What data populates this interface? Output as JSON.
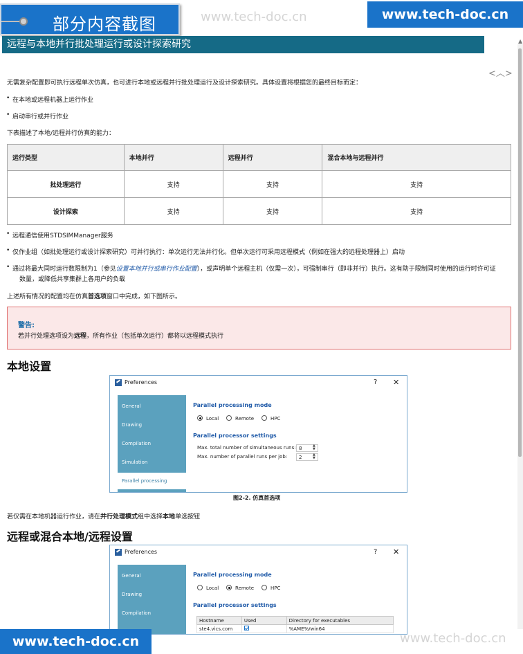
{
  "badge": {
    "text": "部分内容截图"
  },
  "watermark": {
    "top": "www.tech-doc.cn",
    "bottom": "www.tech-doc.cn"
  },
  "brand": {
    "top": "www.tech-doc.cn",
    "bottom": "www.tech-doc.cn"
  },
  "header": {
    "title": "远程与本地并行批处理运行或设计探索研究"
  },
  "nav": {
    "prev": "<",
    "next": "︿>"
  },
  "intro": {
    "line1": "无需复杂配置即可执行远程单次仿真，也可进行本地或远程并行批处理运行及设计探索研究。具体设置将根据您的最终目标而定：",
    "bullets": [
      "在本地或远程机器上运行作业",
      "启动串行或并行作业"
    ],
    "line2": "下表描述了本地/远程并行仿真的能力："
  },
  "capability_table": {
    "headers": [
      "运行类型",
      "本地并行",
      "远程并行",
      "混合本地与远程并行"
    ],
    "rows": [
      [
        "批处理运行",
        "支持",
        "支持",
        "支持"
      ],
      [
        "设计探索",
        "支持",
        "支持",
        "支持"
      ]
    ]
  },
  "notes": {
    "b1": "远程通信使用STDSIMManager服务",
    "b2": "仅作业组（如批处理运行或设计探索研究）可并行执行：单次运行无法并行化。但单次运行可采用远程模式（例如在强大的远程处理器上）启动",
    "b3_pre": "通过将最大同时运行数限制为1（参见",
    "b3_link": "设置本地并行或串行作业配置",
    "b3_post": "），或声明单个远程主机（仅需一次），可强制串行（即非并行）执行。这有助于限制同时使用的运行时许可证",
    "b3_line2": "数量，或降低共享集群上各用户的负载",
    "config_pre": "上述所有情况的配置均在仿真",
    "config_bold": "首选项",
    "config_post": "窗口中完成，如下图所示。"
  },
  "warning": {
    "title": "警告:",
    "text_pre": "若并行处理选项设为",
    "text_bold": "远程",
    "text_post": "，所有作业（包括单次运行）都将以远程模式执行"
  },
  "section_local": {
    "heading": "本地设置",
    "dialog": {
      "title": "Preferences",
      "help": "?",
      "close": "✕",
      "sidebar": [
        "General",
        "Drawing",
        "Compilation",
        "Simulation",
        "Parallel processing"
      ],
      "mode_title": "Parallel processing mode",
      "modes": [
        "Local",
        "Remote",
        "HPC"
      ],
      "selected_mode": "Local",
      "settings_title": "Parallel processor settings",
      "fields": [
        {
          "label": "Max. total number of simultaneous runs:",
          "value": "8"
        },
        {
          "label": "Max. number of parallel runs per job:",
          "value": "2"
        }
      ]
    },
    "caption": "图2-2. 仿真首选项",
    "after_pre": "若仅需在本地机器运行作业，请在",
    "after_bold1": "并行处理模式",
    "after_mid": "组中选择",
    "after_bold2": "本地",
    "after_post": "单选按钮"
  },
  "section_remote": {
    "heading": "远程或混合本地/远程设置",
    "dialog": {
      "title": "Preferences",
      "help": "?",
      "close": "✕",
      "sidebar": [
        "General",
        "Drawing",
        "Compilation"
      ],
      "mode_title": "Parallel processing mode",
      "modes": [
        "Local",
        "Remote",
        "HPC"
      ],
      "selected_mode": "Remote",
      "settings_title": "Parallel processor settings",
      "host_table": {
        "headers": [
          "Hostname",
          "Used",
          "Directory for executables"
        ],
        "rows": [
          [
            "ste4.vics.com",
            "",
            "%AME%/win64"
          ]
        ]
      }
    }
  }
}
